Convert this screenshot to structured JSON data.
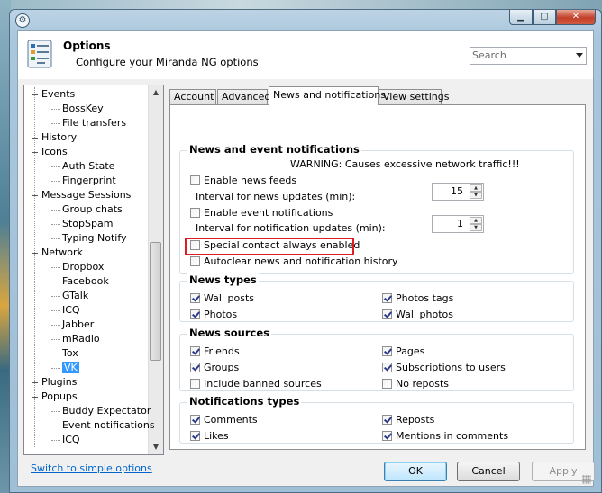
{
  "window": {
    "app_icon": "gear-icon"
  },
  "header": {
    "title": "Options",
    "subtitle": "Configure your Miranda NG options",
    "search_placeholder": "Search"
  },
  "tree": {
    "items": [
      {
        "label": "Events",
        "level": 0,
        "expanded": true
      },
      {
        "label": "BossKey",
        "level": 1
      },
      {
        "label": "File transfers",
        "level": 1
      },
      {
        "label": "History",
        "level": 0
      },
      {
        "label": "Icons",
        "level": 0,
        "expanded": true
      },
      {
        "label": "Auth State",
        "level": 1
      },
      {
        "label": "Fingerprint",
        "level": 1
      },
      {
        "label": "Message Sessions",
        "level": 0,
        "expanded": true
      },
      {
        "label": "Group chats",
        "level": 1
      },
      {
        "label": "StopSpam",
        "level": 1
      },
      {
        "label": "Typing Notify",
        "level": 1
      },
      {
        "label": "Network",
        "level": 0,
        "expanded": true
      },
      {
        "label": "Dropbox",
        "level": 1
      },
      {
        "label": "Facebook",
        "level": 1
      },
      {
        "label": "GTalk",
        "level": 1
      },
      {
        "label": "ICQ",
        "level": 1
      },
      {
        "label": "Jabber",
        "level": 1
      },
      {
        "label": "mRadio",
        "level": 1
      },
      {
        "label": "Tox",
        "level": 1
      },
      {
        "label": "VK",
        "level": 1,
        "selected": true
      },
      {
        "label": "Plugins",
        "level": 0
      },
      {
        "label": "Popups",
        "level": 0,
        "expanded": true
      },
      {
        "label": "Buddy Expectator",
        "level": 1
      },
      {
        "label": "Event notifications",
        "level": 1
      },
      {
        "label": "ICQ",
        "level": 1
      }
    ]
  },
  "tabs": [
    {
      "label": "Account"
    },
    {
      "label": "Advanced"
    },
    {
      "label": "News and notifications",
      "active": true
    },
    {
      "label": "View settings"
    }
  ],
  "panel": {
    "news_event": {
      "title": "News and event notifications",
      "warning": "WARNING: Causes excessive network traffic!!!",
      "enable_news_feeds": {
        "label": "Enable news feeds",
        "checked": false
      },
      "news_interval_label": "Interval for news updates (min):",
      "news_interval_value": "15",
      "enable_event_notifications": {
        "label": "Enable event notifications",
        "checked": false
      },
      "notif_interval_label": "Interval for notification updates (min):",
      "notif_interval_value": "1",
      "special_contact": {
        "label": "Special contact always enabled",
        "checked": false
      },
      "autoclear": {
        "label": "Autoclear news and notification history",
        "checked": false
      }
    },
    "news_types": {
      "title": "News types",
      "items": [
        {
          "label": "Wall posts",
          "checked": true
        },
        {
          "label": "Photos tags",
          "checked": true
        },
        {
          "label": "Photos",
          "checked": true
        },
        {
          "label": "Wall photos",
          "checked": true
        }
      ]
    },
    "news_sources": {
      "title": "News sources",
      "items": [
        {
          "label": "Friends",
          "checked": true
        },
        {
          "label": "Pages",
          "checked": true
        },
        {
          "label": "Groups",
          "checked": true
        },
        {
          "label": "Subscriptions to users",
          "checked": true
        },
        {
          "label": "Include banned sources",
          "checked": false
        },
        {
          "label": "No reposts",
          "checked": false
        }
      ]
    },
    "notif_types": {
      "title": "Notifications types",
      "items": [
        {
          "label": "Comments",
          "checked": true
        },
        {
          "label": "Reposts",
          "checked": true
        },
        {
          "label": "Likes",
          "checked": true
        },
        {
          "label": "Mentions in comments",
          "checked": true
        }
      ]
    }
  },
  "footer": {
    "simple_link": "Switch to simple options",
    "ok": "OK",
    "cancel": "Cancel",
    "apply": "Apply"
  },
  "colors": {
    "highlight_border": "#e11b22",
    "selection": "#3399ff",
    "link": "#0066cc"
  }
}
